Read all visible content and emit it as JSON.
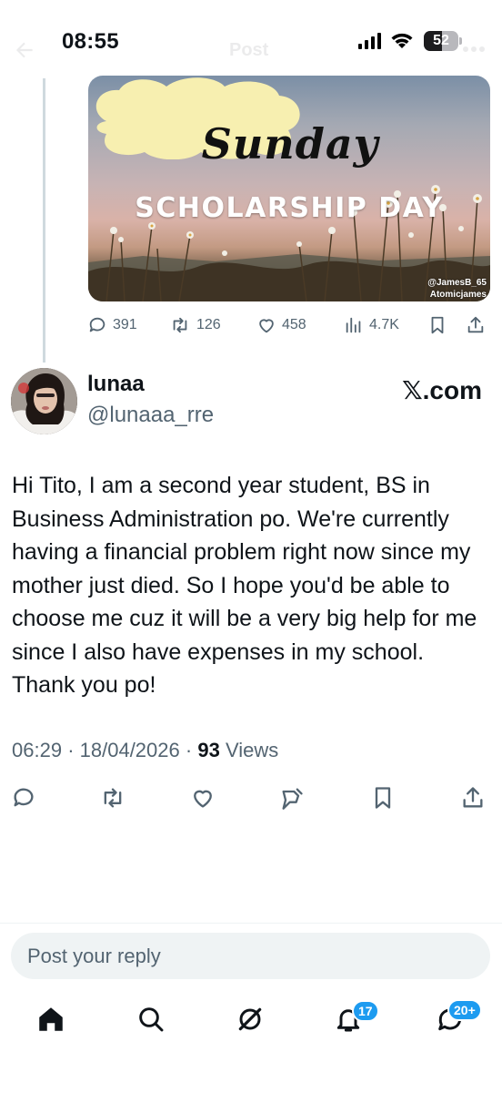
{
  "status_bar": {
    "time": "08:55",
    "battery": "52",
    "battery_level": 0.52,
    "ghost_title": "Post"
  },
  "previous_post": {
    "media": {
      "script_text": "Sunday",
      "headline": "SCHOLARSHIP DAY",
      "credit_1": "@JamesB_65",
      "credit_2": "Atomicjames"
    },
    "actions": {
      "replies": "391",
      "reposts": "126",
      "likes": "458",
      "views": "4.7K"
    }
  },
  "post": {
    "display_name": "lunaa",
    "handle": "@lunaaa_rre",
    "source_label": "𝕏.com",
    "body": "Hi Tito, I am a second year student, BS in Business Administration po. We're currently having a financial problem right now since my mother just died. So I hope you'd be able to choose me cuz it will be a very big help for me since I also have expenses in my school. Thank you po!",
    "time": "06:29",
    "date": "18/04/2026",
    "views_count": "93",
    "views_label": "Views"
  },
  "reply": {
    "placeholder": "Post your reply"
  },
  "bottom_nav": {
    "notifications_badge": "17",
    "messages_badge": "20+"
  },
  "colors": {
    "text_primary": "#0f1419",
    "text_secondary": "#536471",
    "accent": "#1d9bf0",
    "divider": "#cfd9de",
    "reply_bg": "#eff3f4"
  },
  "icons": [
    "back-arrow-icon",
    "more-icon",
    "signal-icon",
    "wifi-icon",
    "battery-icon",
    "reply-icon",
    "repost-icon",
    "like-icon",
    "views-icon",
    "bookmark-icon",
    "share-icon",
    "grok-icon",
    "home-icon",
    "search-icon",
    "notifications-icon",
    "messages-icon"
  ]
}
